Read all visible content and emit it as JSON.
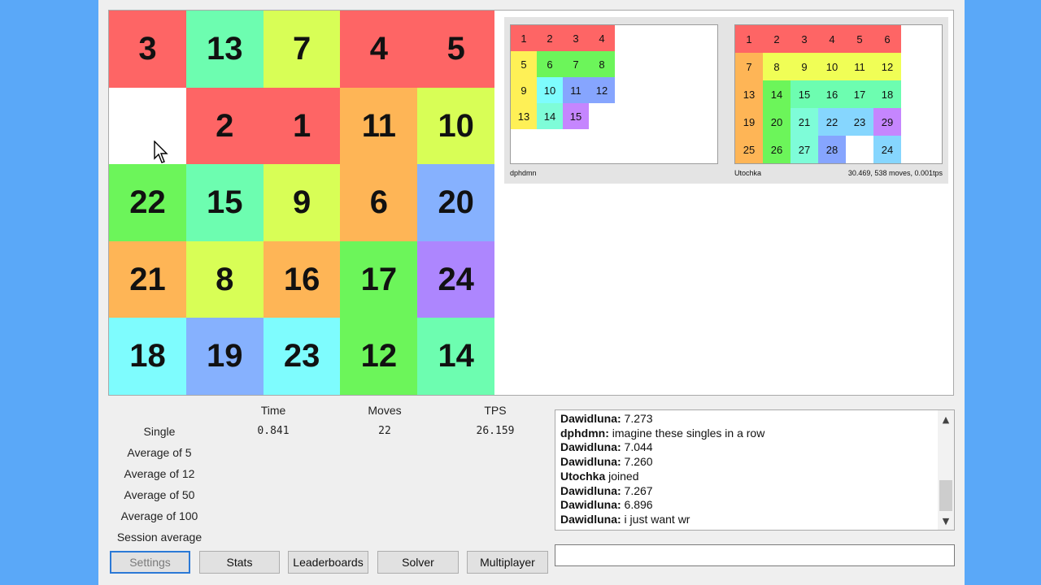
{
  "main_board": {
    "tiles": [
      {
        "n": "3",
        "c": "#fe6565"
      },
      {
        "n": "13",
        "c": "#6dfdb0"
      },
      {
        "n": "7",
        "c": "#d8fe56"
      },
      {
        "n": "4",
        "c": "#fe6565"
      },
      {
        "n": "5",
        "c": "#fe6565"
      },
      {
        "n": "",
        "c": "#ffffff"
      },
      {
        "n": "2",
        "c": "#fe6565"
      },
      {
        "n": "1",
        "c": "#fe6565"
      },
      {
        "n": "11",
        "c": "#feb556"
      },
      {
        "n": "10",
        "c": "#d8fe56"
      },
      {
        "n": "22",
        "c": "#6cf55a"
      },
      {
        "n": "15",
        "c": "#6dfdb0"
      },
      {
        "n": "9",
        "c": "#d8fe56"
      },
      {
        "n": "6",
        "c": "#feb556"
      },
      {
        "n": "20",
        "c": "#86b1fe"
      },
      {
        "n": "21",
        "c": "#feb556"
      },
      {
        "n": "8",
        "c": "#d8fe56"
      },
      {
        "n": "16",
        "c": "#feb556"
      },
      {
        "n": "17",
        "c": "#6cf55a"
      },
      {
        "n": "24",
        "c": "#ad86fe"
      },
      {
        "n": "18",
        "c": "#7efcfe"
      },
      {
        "n": "19",
        "c": "#86b1fe"
      },
      {
        "n": "23",
        "c": "#7efcfe"
      },
      {
        "n": "12",
        "c": "#6cf55a"
      },
      {
        "n": "14",
        "c": "#6dfdb0"
      }
    ]
  },
  "multiplayer": {
    "players": [
      {
        "name": "dphdmn",
        "stats": "",
        "tiles": [
          {
            "n": "1",
            "c": "#fe6565"
          },
          {
            "n": "2",
            "c": "#fe6565"
          },
          {
            "n": "3",
            "c": "#fe6565"
          },
          {
            "n": "4",
            "c": "#fe6565"
          },
          {
            "n": "5",
            "c": "#fef056"
          },
          {
            "n": "6",
            "c": "#6cf55a"
          },
          {
            "n": "7",
            "c": "#6cf55a"
          },
          {
            "n": "8",
            "c": "#6cf55a"
          },
          {
            "n": "9",
            "c": "#fef056"
          },
          {
            "n": "10",
            "c": "#7efcfe"
          },
          {
            "n": "11",
            "c": "#86a5fe"
          },
          {
            "n": "12",
            "c": "#86a5fe"
          },
          {
            "n": "13",
            "c": "#fef056"
          },
          {
            "n": "14",
            "c": "#7efcd8"
          },
          {
            "n": "15",
            "c": "#c586fe"
          },
          {
            "n": "",
            "c": ""
          }
        ]
      },
      {
        "name": "Utochka",
        "stats": "30.469, 538 moves, 0.001tps",
        "tiles": [
          {
            "n": "1",
            "c": "#fe6565"
          },
          {
            "n": "2",
            "c": "#fe6565"
          },
          {
            "n": "3",
            "c": "#fe6565"
          },
          {
            "n": "4",
            "c": "#fe6565"
          },
          {
            "n": "5",
            "c": "#fe6565"
          },
          {
            "n": "6",
            "c": "#fe6565"
          },
          {
            "n": "7",
            "c": "#feb556"
          },
          {
            "n": "8",
            "c": "#f0fe56"
          },
          {
            "n": "9",
            "c": "#f0fe56"
          },
          {
            "n": "10",
            "c": "#f0fe56"
          },
          {
            "n": "11",
            "c": "#f0fe56"
          },
          {
            "n": "12",
            "c": "#f0fe56"
          },
          {
            "n": "13",
            "c": "#feb556"
          },
          {
            "n": "14",
            "c": "#6cf55a"
          },
          {
            "n": "15",
            "c": "#6dfdb0"
          },
          {
            "n": "16",
            "c": "#6dfdb0"
          },
          {
            "n": "17",
            "c": "#6dfdb0"
          },
          {
            "n": "18",
            "c": "#6dfdb0"
          },
          {
            "n": "19",
            "c": "#feb556"
          },
          {
            "n": "20",
            "c": "#6cf55a"
          },
          {
            "n": "21",
            "c": "#7efcd8"
          },
          {
            "n": "22",
            "c": "#86d6fe"
          },
          {
            "n": "23",
            "c": "#86d6fe"
          },
          {
            "n": "29",
            "c": "#c586fe"
          },
          {
            "n": "25",
            "c": "#feb556"
          },
          {
            "n": "26",
            "c": "#6cf55a"
          },
          {
            "n": "27",
            "c": "#7efcd8"
          },
          {
            "n": "28",
            "c": "#86a5fe"
          },
          {
            "n": "",
            "c": "#ffffff"
          },
          {
            "n": "24",
            "c": "#86d6fe"
          }
        ]
      }
    ]
  },
  "stats": {
    "headers": [
      "Time",
      "Moves",
      "TPS"
    ],
    "rows": [
      {
        "label": "Single",
        "time": "0.841",
        "moves": "22",
        "tps": "26.159"
      },
      {
        "label": "Average of 5",
        "time": "",
        "moves": "",
        "tps": ""
      },
      {
        "label": "Average of 12",
        "time": "",
        "moves": "",
        "tps": ""
      },
      {
        "label": "Average of 50",
        "time": "",
        "moves": "",
        "tps": ""
      },
      {
        "label": "Average of 100",
        "time": "",
        "moves": "",
        "tps": ""
      },
      {
        "label": "Session average",
        "time": "",
        "moves": "",
        "tps": ""
      }
    ]
  },
  "chat": {
    "lines": [
      {
        "user": "Dawidluna:",
        "text": " 7.273"
      },
      {
        "user": "dphdmn:",
        "text": " imagine these singles in a row"
      },
      {
        "user": "Dawidluna:",
        "text": " 7.044"
      },
      {
        "user": "Dawidluna:",
        "text": " 7.260"
      },
      {
        "user": "Utochka",
        "text": " joined"
      },
      {
        "user": "Dawidluna:",
        "text": " 7.267"
      },
      {
        "user": "Dawidluna:",
        "text": " 6.896"
      },
      {
        "user": "Dawidluna:",
        "text": " i just want wr"
      }
    ],
    "scroll_up_icon": "▲",
    "scroll_down_icon": "▼",
    "input_value": ""
  },
  "buttons": {
    "settings": "Settings",
    "stats": "Stats",
    "leaderboards": "Leaderboards",
    "solver": "Solver",
    "multiplayer": "Multiplayer"
  }
}
